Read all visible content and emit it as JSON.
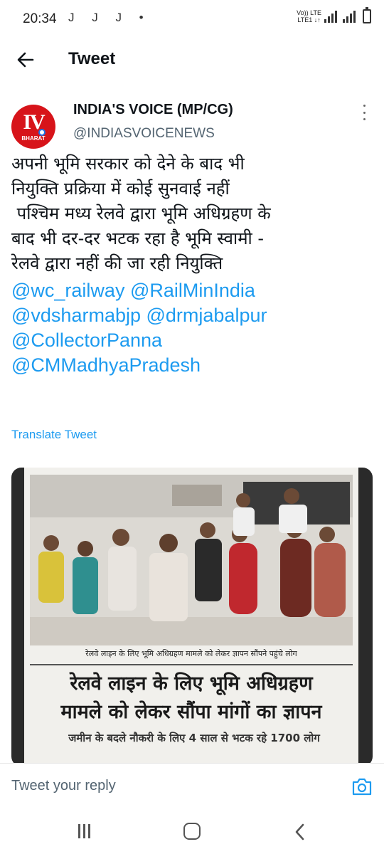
{
  "status_bar": {
    "time": "20:34",
    "notifications": "J J J •",
    "network_top": "Vo)) LTE",
    "network_bottom": "LTE1 ↓↑"
  },
  "header": {
    "title": "Tweet"
  },
  "tweet": {
    "author_name": "INDIA'S VOICE (MP/CG)",
    "author_handle": "@INDIASVOICENEWS",
    "avatar": {
      "letters": "IV",
      "sub": "BHARAT",
      "color": "#d7141a"
    },
    "text_lines": [
      "अपनी भूमि सरकार को देने के बाद भी",
      "नियुक्ति प्रक्रिया में कोई सुनवाई नहीं",
      " पश्चिम मध्य रेलवे द्वारा भूमि अधिग्रहण के",
      "बाद भी दर-दर भटक रहा है भूमि स्वामी -",
      "रेलवे द्वारा नहीं की जा रही नियुक्ति"
    ],
    "mention_lines": [
      "@wc_railway @RailMinIndia",
      "@vdsharmabjp @drmjabalpur",
      "@CollectorPanna",
      "@CMMadhyaPradesh"
    ],
    "translate_label": "Translate Tweet",
    "link_color": "#1d9bf0"
  },
  "media": {
    "photo_caption": "रेलवे लाइन के लिए भूमि अधिग्रहण मामले को लेकर ज्ञापन सौंपने पहुंचे लोग",
    "headline_line1": "रेलवे लाइन के लिए भूमि अधिग्रहण",
    "headline_line2": "मामले को लेकर सौंपा मांगों का ज्ञापन",
    "subhead": "जमीन के बदले नौकरी के लिए 4 साल से भटक रहे 1700 लोग"
  },
  "reply": {
    "placeholder": "Tweet your reply"
  },
  "icons": {
    "back": "arrow-left-icon",
    "more": "more-vertical-icon",
    "camera": "camera-icon",
    "nav_recents": "recents-icon",
    "nav_home": "home-icon",
    "nav_back": "chevron-left-icon"
  }
}
